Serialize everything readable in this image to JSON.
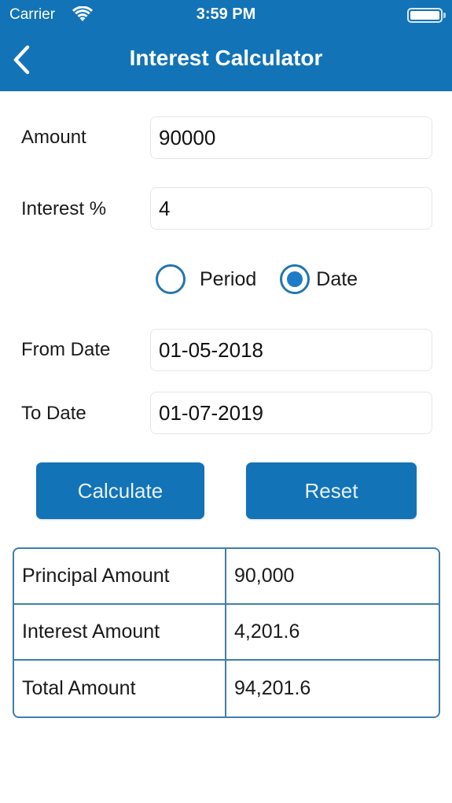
{
  "status_bar": {
    "carrier": "Carrier",
    "time": "3:59 PM",
    "wifi_icon": "wifi-icon",
    "battery_icon": "battery-icon"
  },
  "nav": {
    "title": "Interest Calculator",
    "back_icon": "chevron-left-icon"
  },
  "form": {
    "amount": {
      "label": "Amount",
      "value": "90000"
    },
    "interest": {
      "label": "Interest %",
      "value": "4"
    },
    "mode": {
      "options": [
        {
          "label": "Period",
          "selected": false
        },
        {
          "label": "Date",
          "selected": true
        }
      ]
    },
    "from_date": {
      "label": "From Date",
      "value": "01-05-2018"
    },
    "to_date": {
      "label": "To Date",
      "value": "01-07-2019"
    }
  },
  "buttons": {
    "calculate": "Calculate",
    "reset": "Reset"
  },
  "results": [
    {
      "label": "Principal Amount",
      "value": "90,000"
    },
    {
      "label": "Interest Amount",
      "value": "4,201.6"
    },
    {
      "label": "Total Amount",
      "value": "94,201.6"
    }
  ],
  "colors": {
    "primary": "#1273b7",
    "table_border": "#3f7fa6",
    "radio_accent": "#1d7cc8"
  }
}
